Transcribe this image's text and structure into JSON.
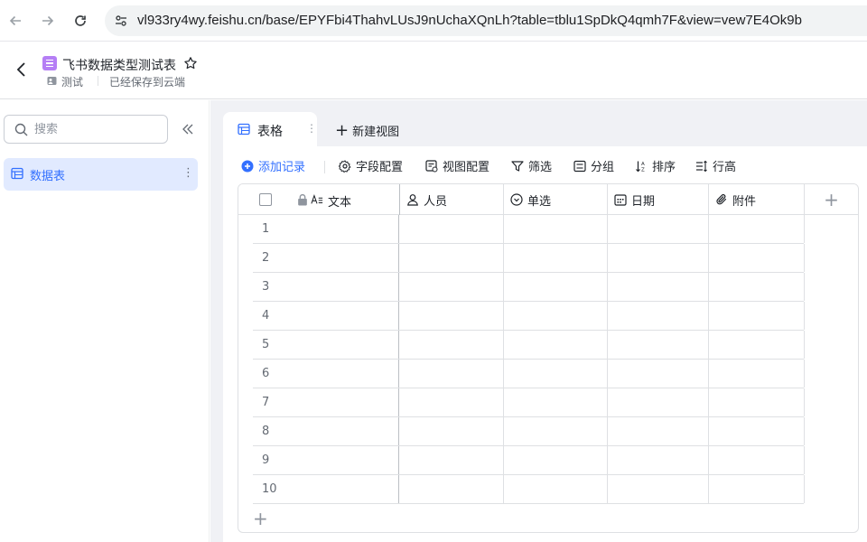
{
  "browser": {
    "url": "vl933ry4wy.feishu.cn/base/EPYFbi4ThahvLUsJ9nUchaXQnLh?table=tblu1SpDkQ4qmh7F&view=vew7E4Ok9b"
  },
  "header": {
    "title": "飞书数据类型测试表",
    "workspace": "测试",
    "save_status": "已经保存到云端",
    "icon_color": "#b57ef5"
  },
  "sidebar": {
    "search_placeholder": "搜索",
    "tables": [
      {
        "label": "数据表",
        "more": "⋮",
        "selected": true
      }
    ]
  },
  "views": {
    "tabs": [
      {
        "label": "表格",
        "more": "⋮",
        "active": true
      }
    ],
    "new_view_label": "新建视图"
  },
  "toolbar": {
    "add_record": "添加记录",
    "field_config": "字段配置",
    "view_config": "视图配置",
    "filter": "筛选",
    "group": "分组",
    "sort": "排序",
    "row_height": "行高"
  },
  "grid": {
    "columns": [
      {
        "name": "文本",
        "icon": "text-field-icon"
      },
      {
        "name": "人员",
        "icon": "person-field-icon"
      },
      {
        "name": "单选",
        "icon": "single-select-field-icon"
      },
      {
        "name": "日期",
        "icon": "date-field-icon"
      },
      {
        "name": "附件",
        "icon": "attachment-field-icon"
      }
    ],
    "rows": [
      "1",
      "2",
      "3",
      "4",
      "5",
      "6",
      "7",
      "8",
      "9",
      "10"
    ]
  },
  "colors": {
    "accent": "#3370ff",
    "selected_bg": "#e1eaff",
    "canvas_bg": "#f0f1f5"
  }
}
